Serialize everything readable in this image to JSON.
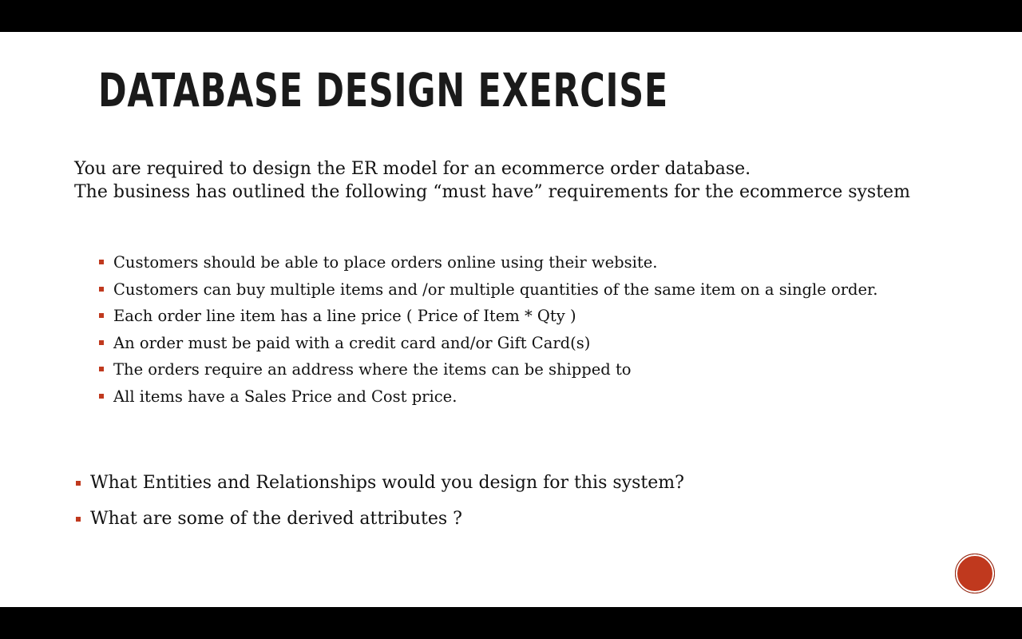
{
  "slide": {
    "title": "DATABASE DESIGN EXERCISE",
    "intro_line1": "You are required to design the ER model for an ecommerce order database.",
    "intro_line2": "The business has outlined the following “must have” requirements for the ecommerce system",
    "requirements": [
      "Customers should be able to place orders online using their website.",
      "Customers can buy multiple items  and /or multiple quantities of the same item  on a single order.",
      "Each order line item has a line price ( Price of Item * Qty )",
      "An order must be paid with  a credit card  and/or Gift Card(s)",
      "The orders require an address where the items can be shipped to",
      "All items have a Sales Price and Cost price."
    ],
    "questions": [
      "What Entities and Relationships would you design for this system?",
      "What are some of the derived attributes ?"
    ]
  },
  "icons": {
    "bullet": "square-bullet",
    "nav": "circle-button"
  },
  "colors": {
    "accent": "#c0391e",
    "text": "#111111",
    "background": "#ffffff",
    "letterbox": "#000000"
  }
}
